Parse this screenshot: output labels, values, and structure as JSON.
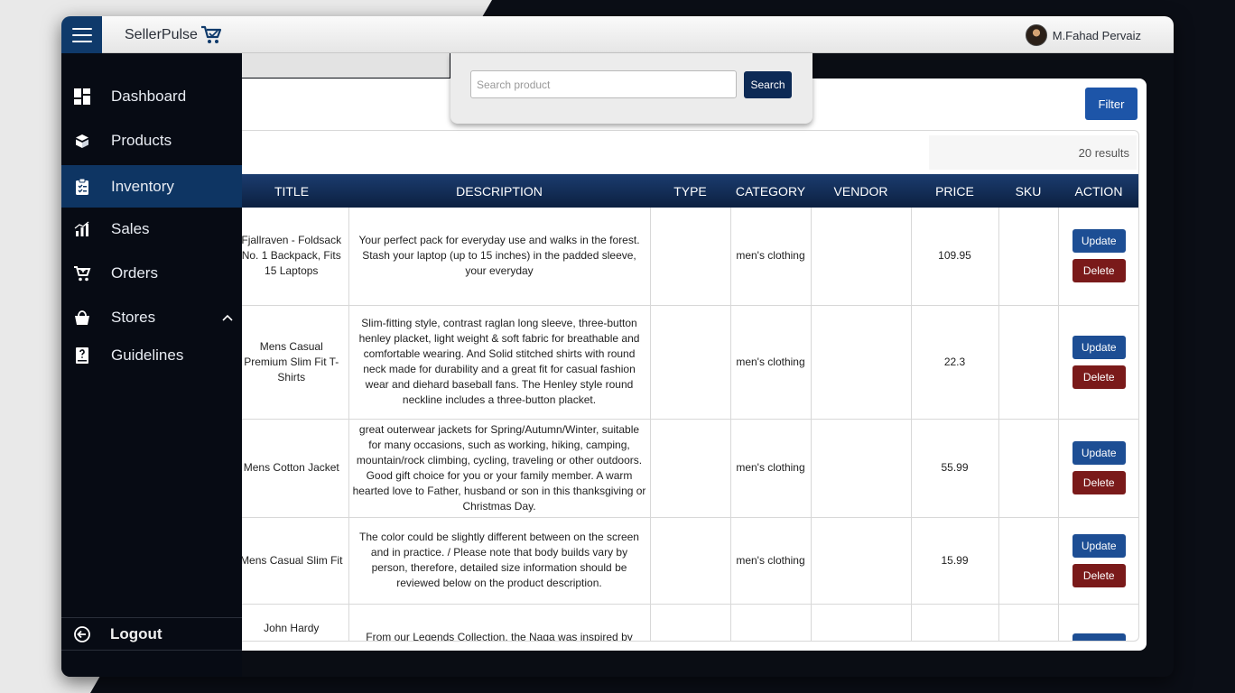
{
  "brand": {
    "name": "SellerPulse"
  },
  "user": {
    "name": "M.Fahad Pervaiz"
  },
  "sidebar": {
    "items": [
      {
        "label": "Dashboard",
        "icon": "dashboard-icon"
      },
      {
        "label": "Products",
        "icon": "products-icon"
      },
      {
        "label": "Inventory",
        "icon": "clipboard-icon",
        "active": true
      },
      {
        "label": "Sales",
        "icon": "bar-chart-icon"
      },
      {
        "label": "Orders",
        "icon": "cart-icon"
      },
      {
        "label": "Stores",
        "icon": "bag-icon",
        "expanded": true
      },
      {
        "label": "Guidelines",
        "icon": "help-book-icon"
      }
    ],
    "logout_label": "Logout"
  },
  "search": {
    "placeholder": "Search product",
    "button_label": "Search"
  },
  "toolbar": {
    "filter_label": "Filter",
    "results_text": "20 results"
  },
  "table": {
    "columns": [
      "TITLE",
      "DESCRIPTION",
      "TYPE",
      "CATEGORY",
      "VENDOR",
      "PRICE",
      "SKU",
      "ACTION"
    ],
    "update_label": "Update",
    "delete_label": "Delete",
    "rows": [
      {
        "title": "Fjallraven - Foldsack No. 1 Backpack, Fits 15 Laptops",
        "description": "Your perfect pack for everyday use and walks in the forest. Stash your laptop (up to 15 inches) in the padded sleeve, your everyday",
        "type": "",
        "category": "men's clothing",
        "vendor": "",
        "price": "109.95",
        "sku": ""
      },
      {
        "title": "Mens Casual Premium Slim Fit T-Shirts",
        "description": "Slim-fitting style, contrast raglan long sleeve, three-button henley placket, light weight & soft fabric for breathable and comfortable wearing. And Solid stitched shirts with round neck made for durability and a great fit for casual fashion wear and diehard baseball fans. The Henley style round neckline includes a three-button placket.",
        "type": "",
        "category": "men's clothing",
        "vendor": "",
        "price": "22.3",
        "sku": ""
      },
      {
        "title": "Mens Cotton Jacket",
        "description": "great outerwear jackets for Spring/Autumn/Winter, suitable for many occasions, such as working, hiking, camping, mountain/rock climbing, cycling, traveling or other outdoors. Good gift choice for you or your family member. A warm hearted love to Father, husband or son in this thanksgiving or Christmas Day.",
        "type": "",
        "category": "men's clothing",
        "vendor": "",
        "price": "55.99",
        "sku": ""
      },
      {
        "title": "Mens Casual Slim Fit",
        "description": "The color could be slightly different between on the screen and in practice. / Please note that body builds vary by person, therefore, detailed size information should be reviewed below on the product description.",
        "type": "",
        "category": "men's clothing",
        "vendor": "",
        "price": "15.99",
        "sku": ""
      },
      {
        "title": "John Hardy",
        "description": "From our Legends Collection, the Naga was inspired by",
        "type": "",
        "category": "",
        "vendor": "",
        "price": "",
        "sku": ""
      }
    ]
  }
}
